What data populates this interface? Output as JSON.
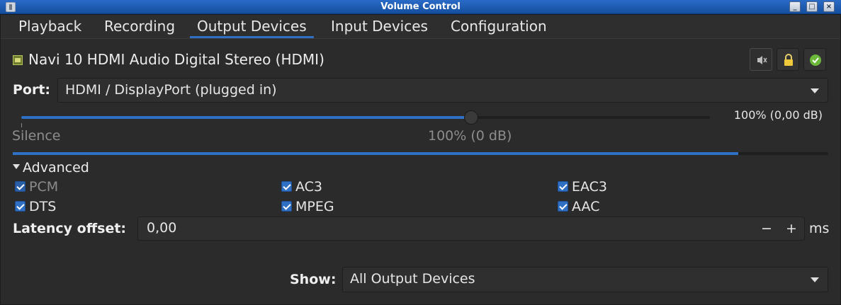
{
  "window": {
    "title": "Volume Control"
  },
  "tabs": [
    {
      "label": "Playback"
    },
    {
      "label": "Recording"
    },
    {
      "label": "Output Devices"
    },
    {
      "label": "Input Devices"
    },
    {
      "label": "Configuration"
    }
  ],
  "active_tab": "Output Devices",
  "device": {
    "name": "Navi 10 HDMI Audio Digital Stereo (HDMI)",
    "port_label": "Port:",
    "port_value": "HDMI / DisplayPort (plugged in)",
    "volume_percent": 100,
    "volume_readout": "100% (0,00 dB)",
    "slider_left_label": "Silence",
    "slider_mark_label": "100% (0 dB)",
    "peak_level": 0.89
  },
  "advanced": {
    "label": "Advanced",
    "formats": [
      {
        "label": "PCM",
        "checked": true,
        "disabled": true
      },
      {
        "label": "AC3",
        "checked": true,
        "disabled": false
      },
      {
        "label": "EAC3",
        "checked": true,
        "disabled": false
      },
      {
        "label": "DTS",
        "checked": true,
        "disabled": false
      },
      {
        "label": "MPEG",
        "checked": true,
        "disabled": false
      },
      {
        "label": "AAC",
        "checked": true,
        "disabled": false
      }
    ],
    "latency_label": "Latency offset:",
    "latency_value": "0,00",
    "latency_minus": "−",
    "latency_plus": "+",
    "latency_unit": "ms"
  },
  "footer": {
    "show_label": "Show:",
    "show_value": "All Output Devices"
  },
  "colors": {
    "accent": "#2f70c4",
    "titlebar": "#1f5fb3",
    "background": "#2b2b2b"
  },
  "icons": [
    "app-icon",
    "mute-icon",
    "lock-icon",
    "default-device-check-icon",
    "sound-card-icon"
  ]
}
